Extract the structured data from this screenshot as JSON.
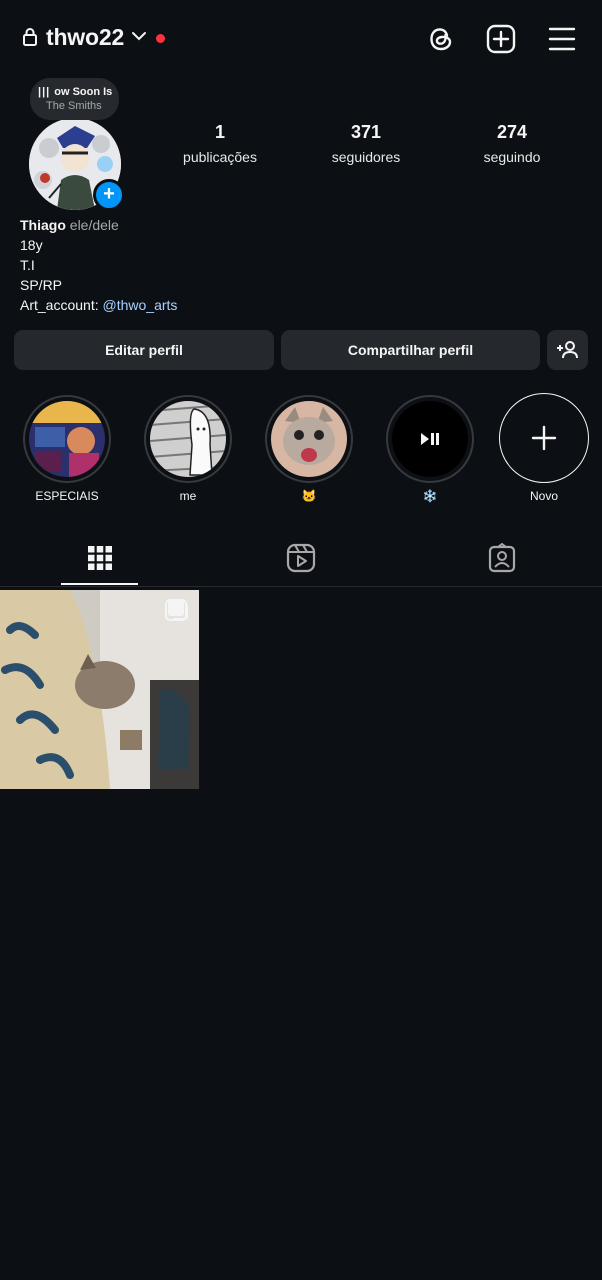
{
  "header": {
    "username": "thwo22",
    "notification_dot_color": "#ff3040",
    "icons": [
      "lock-icon",
      "chevron-down-icon",
      "threads-icon",
      "new-post-icon",
      "menu-icon"
    ]
  },
  "note": {
    "song": "ow Soon Is",
    "artist": "The Smiths"
  },
  "stats": [
    {
      "num": "1",
      "label": "publicações"
    },
    {
      "num": "371",
      "label": "seguidores"
    },
    {
      "num": "274",
      "label": "seguindo"
    }
  ],
  "bio": {
    "name": "Thiago",
    "pronouns": "ele/dele",
    "lines": [
      "18y",
      "T.I",
      "SP/RP"
    ],
    "art_prefix": "Art_account: ",
    "art_mention": "@thwo_arts"
  },
  "buttons": {
    "edit": "Editar perfil",
    "share": "Compartilhar perfil"
  },
  "highlights": [
    {
      "label": "ESPECIAIS"
    },
    {
      "label": "me"
    },
    {
      "label": "🐱"
    },
    {
      "label": "❄️"
    },
    {
      "label": "Novo"
    }
  ],
  "colors": {
    "background": "#0c1014",
    "button": "#25292e",
    "accent_blue": "#0095f6"
  }
}
